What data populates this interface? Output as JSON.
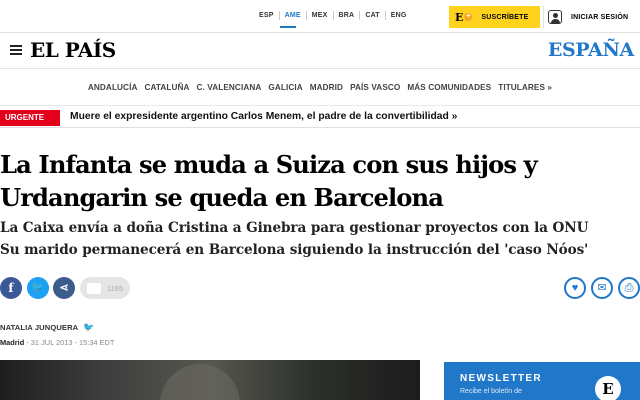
{
  "topbar": {
    "editions": [
      "ESP",
      "AME",
      "MEX",
      "BRA",
      "CAT",
      "ENG"
    ],
    "active_edition": "AME",
    "subscribe_logo": "E",
    "subscribe_plus": "+",
    "subscribe_label": "SUSCRÍBETE",
    "login_label": "INICIAR SESIÓN"
  },
  "header": {
    "logo": "EL PAÍS",
    "edition": "ESPAÑA"
  },
  "regions": [
    "ANDALUCÍA",
    "CATALUÑA",
    "C. VALENCIANA",
    "GALICIA",
    "MADRID",
    "PAÍS VASCO",
    "MÁS COMUNIDADES",
    "TITULARES »"
  ],
  "urgent": {
    "tag": "URGENTE",
    "headline": "Muere el expresidente argentino Carlos Menem, el padre de la convertibilidad »"
  },
  "article": {
    "title": "La Infanta se muda a Suiza con sus hijos y Urdangarin se queda en Barcelona",
    "subheads": [
      "La Caixa envía a doña Cristina a Ginebra para gestionar proyectos con la ONU",
      "Su marido permanecerá en Barcelona siguiendo la instrucción del 'caso Nóos'"
    ],
    "author": "NATALIA JUNQUERA",
    "city": "Madrid",
    "date": " - 31 JUL 2013 - 15:34 EDT"
  },
  "share": {
    "comments_count": "1165"
  },
  "newsletter": {
    "title": "NEWSLETTER",
    "text": "Recibe el boletín de",
    "logo": "E"
  },
  "colors": {
    "brand_blue": "#2178c8",
    "urgent_red": "#e2001a",
    "subscribe_yellow": "#ffd31d"
  }
}
